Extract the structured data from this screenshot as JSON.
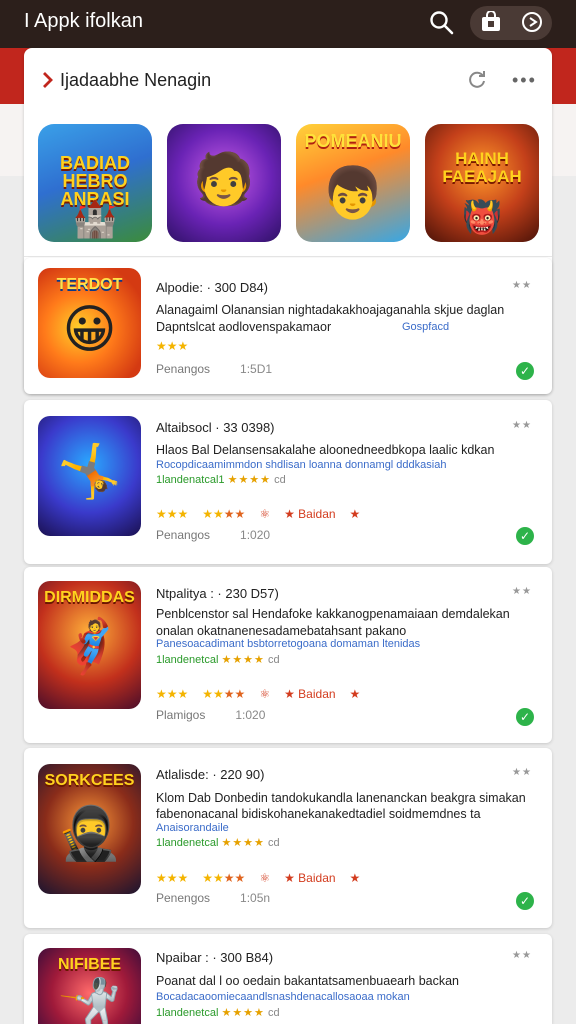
{
  "header": {
    "app_title": "I Appk ifolkan"
  },
  "panel": {
    "title": "Ijadaabhe Nenagin",
    "more": "•••"
  },
  "featured": [
    {
      "text": "BADIAD HEBRO ANRASI",
      "glyph": "🏰"
    },
    {
      "text": "",
      "glyph": "🧑"
    },
    {
      "text": "POMEANIU",
      "glyph": "👦"
    },
    {
      "text": "HAINH FAEAJAH",
      "glyph": "👹"
    }
  ],
  "cards": [
    {
      "icon_text": "TERDOT",
      "icon_glyph": "😀",
      "title": "Alpodie: · 300 D84)",
      "corner": "★★",
      "desc": "Alanagaiml Olanansian nightadakakhoajaganahla skjue daglan",
      "desc2": "Dapntslcat aodlovenspakamaor",
      "blue": "Gospfacd",
      "stars": "★★★",
      "meta_label": "Penangos",
      "meta_value": "1:5D1"
    },
    {
      "icon_text": "",
      "icon_glyph": "🤸",
      "title": "Altaibsocl · 33 0398)",
      "corner": "★★",
      "desc": "Hlaos Bal Delansensakalahe  aloonedneedbkopa  laalic kdkan",
      "blue": "Rocopdicaamimmdon shdlisan loanna donnamgl dddkasiah",
      "green": "1landenatcal1",
      "green_stars": "★★★★",
      "green_tail": "cd",
      "stars_a": "★★★",
      "stars_b": "★★",
      "stars_c": "★★",
      "stars_d": "★ Baidan",
      "stars_e": "★",
      "meta_label": "Penangos",
      "meta_value": "1:020"
    },
    {
      "icon_text": "DIRMIDDAS",
      "icon_glyph": "🦸",
      "title": "Ntpalitya : · 230 D57)",
      "corner": "★★",
      "desc": "Penblcenstor sal Hendafoke kakkanogpenamaiaan demdalekan",
      "desc2": "onalan okatnanenesadamebatahsant pakano",
      "blue": "Panesoacadimant bsbtorretogoana domaman ltenidas",
      "green": "1landenetcal",
      "green_stars": "★★★★",
      "green_tail": "cd",
      "stars_a": "★★★",
      "stars_b": "★★",
      "stars_c": "★★",
      "stars_d": "★ Baidan",
      "stars_e": "★",
      "meta_label": "Plamigos",
      "meta_value": "1:020"
    },
    {
      "icon_text": "SORKCEES",
      "icon_glyph": "🥷",
      "title": "Atlalisde: · 220 90)",
      "corner": "★★",
      "desc": "Klom Dab Donbedin tandokukandla lanenanckan beakgra simakan",
      "desc2": "fabenonacanal bidiskohanekanakedtadiel soidmemdnes ta",
      "blue": "Anaisorandaile",
      "green": "1landenetcal",
      "green_stars": "★★★★",
      "green_tail": "cd",
      "stars_a": "★★★",
      "stars_b": "★★",
      "stars_c": "★★",
      "stars_d": "★ Baidan",
      "stars_e": "★",
      "meta_label": "Penengos",
      "meta_value": "1:05n"
    },
    {
      "icon_text": "NIFIBEE",
      "icon_glyph": "🤺",
      "title": "Npaibar : · 300 B84)",
      "corner": "★★",
      "desc": "Poanat dal l oo oedain bakantatsamenbuaearh backan",
      "blue": "Bocadacaoomiecaandlsnashdenacallosaoaa mokan",
      "green": "1landenetcal",
      "green_stars": "★★★★",
      "green_tail": "cd"
    }
  ]
}
